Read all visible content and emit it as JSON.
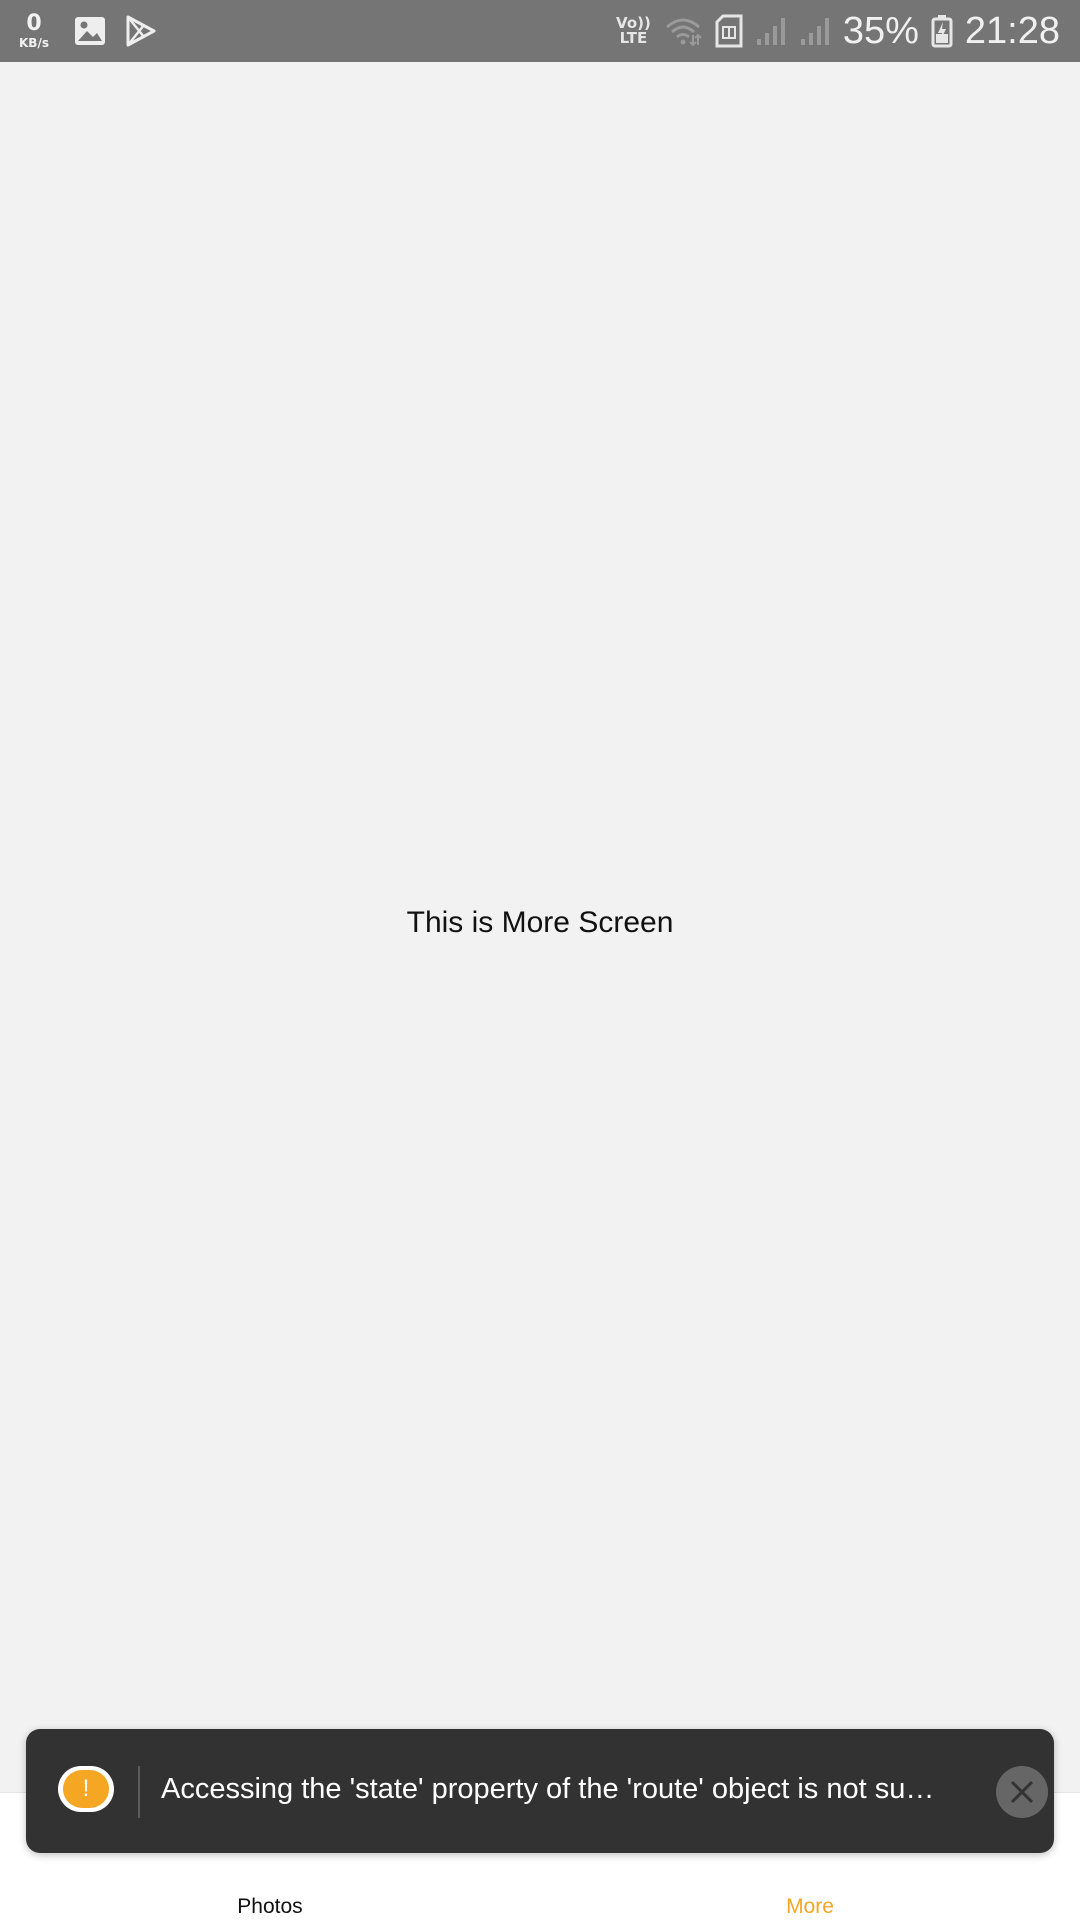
{
  "status_bar": {
    "net_speed_value": "0",
    "net_speed_unit": "KB/s",
    "volte_top": "Vo))",
    "volte_bottom": "LTE",
    "battery_percent": "35%",
    "time": "21:28",
    "icons": [
      "image-icon",
      "play-store-icon",
      "wifi-icon",
      "sim-icon",
      "signal-icon",
      "signal-icon",
      "battery-charging-icon"
    ]
  },
  "main": {
    "title": "This is More Screen"
  },
  "tab_bar": {
    "tabs": [
      {
        "label": "Photos",
        "icon": "photos-icon",
        "active": false
      },
      {
        "label": "More",
        "icon": "more-icon",
        "active": true
      }
    ],
    "active_color": "#f5a623"
  },
  "toast": {
    "icon_text": "!",
    "message": "Accessing the 'state' property of the 'route' object is not su…",
    "icon": "warning-icon",
    "close_icon": "close-icon"
  },
  "colors": {
    "status_bar": "#757575",
    "background": "#f2f2f2",
    "toast_background": "#323232",
    "accent": "#f5a623"
  }
}
